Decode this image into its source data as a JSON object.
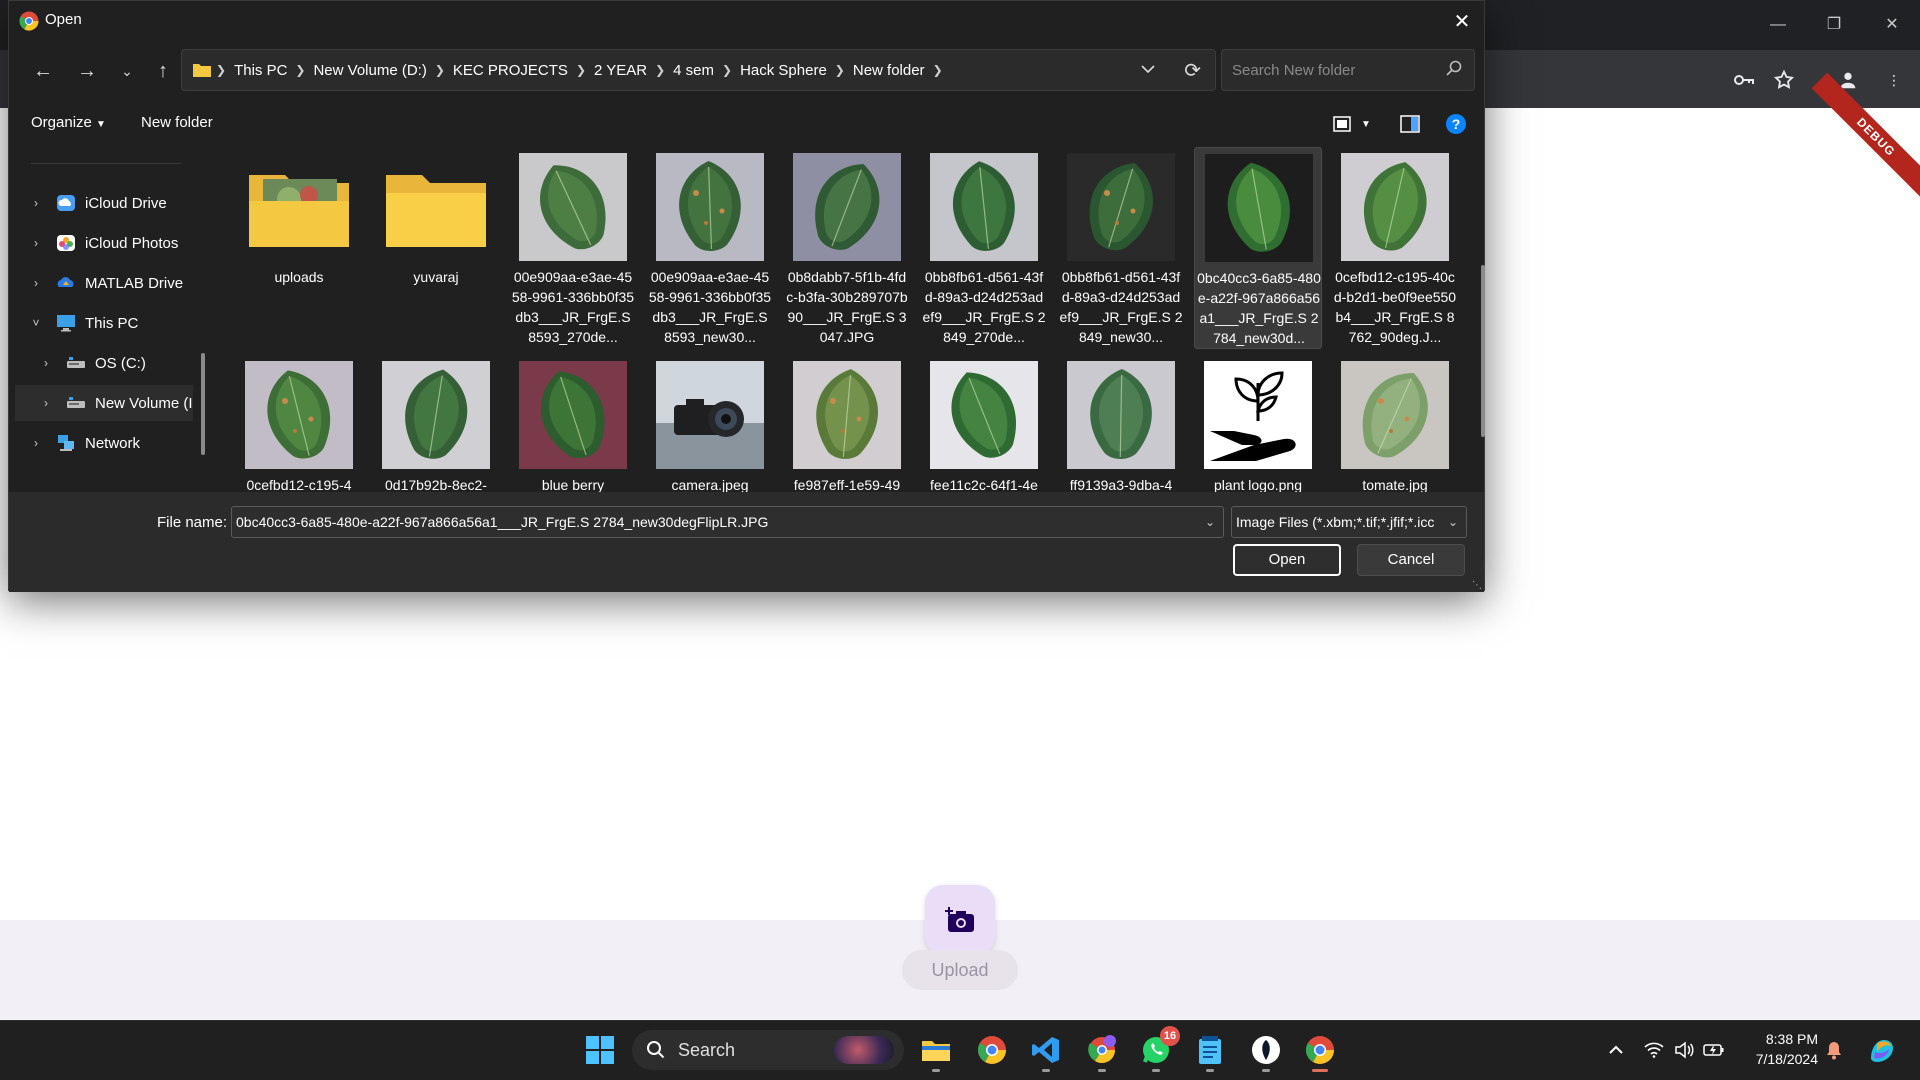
{
  "dialog": {
    "title": "Open",
    "breadcrumb": [
      "This PC",
      "New Volume (D:)",
      "KEC PROJECTS",
      "2 YEAR",
      "4 sem",
      "Hack Sphere",
      "New folder"
    ],
    "search_placeholder": "Search New folder",
    "organize_label": "Organize",
    "new_folder_label": "New folder",
    "nav_items": [
      {
        "label": "iCloud Drive",
        "icon": "icloud-drive-icon"
      },
      {
        "label": "iCloud Photos",
        "icon": "icloud-photos-icon"
      },
      {
        "label": "MATLAB Drive",
        "icon": "matlab-drive-icon"
      },
      {
        "label": "This PC",
        "icon": "this-pc-icon",
        "expanded": true
      },
      {
        "label": "OS (C:)",
        "icon": "drive-icon"
      },
      {
        "label": "New Volume (I",
        "icon": "drive-icon",
        "selected": true
      },
      {
        "label": "Network",
        "icon": "network-icon"
      }
    ],
    "files": [
      {
        "name": "uploads",
        "kind": "folder-photo"
      },
      {
        "name": "yuvaraj",
        "kind": "folder"
      },
      {
        "name": "00e909aa-e3ae-4558-9961-336bb0f35db3___JR_FrgE.S 8593_270de...",
        "kind": "leaf"
      },
      {
        "name": "00e909aa-e3ae-4558-9961-336bb0f35db3___JR_FrgE.S 8593_new30...",
        "kind": "leaf"
      },
      {
        "name": "0b8dabb7-5f1b-4fdc-b3fa-30b289707b90___JR_FrgE.S 3047.JPG",
        "kind": "leaf"
      },
      {
        "name": "0bb8fb61-d561-43fd-89a3-d24d253adef9___JR_FrgE.S 2849_270de...",
        "kind": "leaf"
      },
      {
        "name": "0bb8fb61-d561-43fd-89a3-d24d253adef9___JR_FrgE.S 2849_new30...",
        "kind": "leaf"
      },
      {
        "name": "0bc40cc3-6a85-480e-a22f-967a866a56a1___JR_FrgE.S 2784_new30d...",
        "kind": "leaf",
        "selected": true
      },
      {
        "name": "0cefbd12-c195-40cd-b2d1-be0f9ee550b4___JR_FrgE.S 8762_90deg.J...",
        "kind": "leaf"
      },
      {
        "name": "0cefbd12-c195-4",
        "kind": "leaf"
      },
      {
        "name": "0d17b92b-8ec2-",
        "kind": "leaf"
      },
      {
        "name": "blue berry",
        "kind": "leaf"
      },
      {
        "name": "camera.jpeg",
        "kind": "camera"
      },
      {
        "name": "fe987eff-1e59-49",
        "kind": "leaf"
      },
      {
        "name": "fee11c2c-64f1-4e",
        "kind": "leaf"
      },
      {
        "name": "ff9139a3-9dba-4",
        "kind": "leaf"
      },
      {
        "name": "plant logo.png",
        "kind": "plant-logo"
      },
      {
        "name": "tomate.jpg",
        "kind": "leaf-pale"
      }
    ],
    "file_name_label": "File name:",
    "file_name_value": "0bc40cc3-6a85-480e-a22f-967a866a56a1___JR_FrgE.S 2784_new30degFlipLR.JPG",
    "file_type_value": "Image Files (*.xbm;*.tif;*.jfif;*.icc",
    "open_label": "Open",
    "cancel_label": "Cancel"
  },
  "background_app": {
    "upload_label": "Upload",
    "debug_label": "DEBUG"
  },
  "taskbar": {
    "search_label": "Search",
    "whatsapp_badge": "16",
    "time": "8:38 PM",
    "date": "7/18/2024"
  },
  "colors": {
    "dialog_bg": "#202020",
    "accent_help": "#0a84ff",
    "fab_bg": "#eaddf7",
    "folder_yellow": "#f5c842"
  }
}
